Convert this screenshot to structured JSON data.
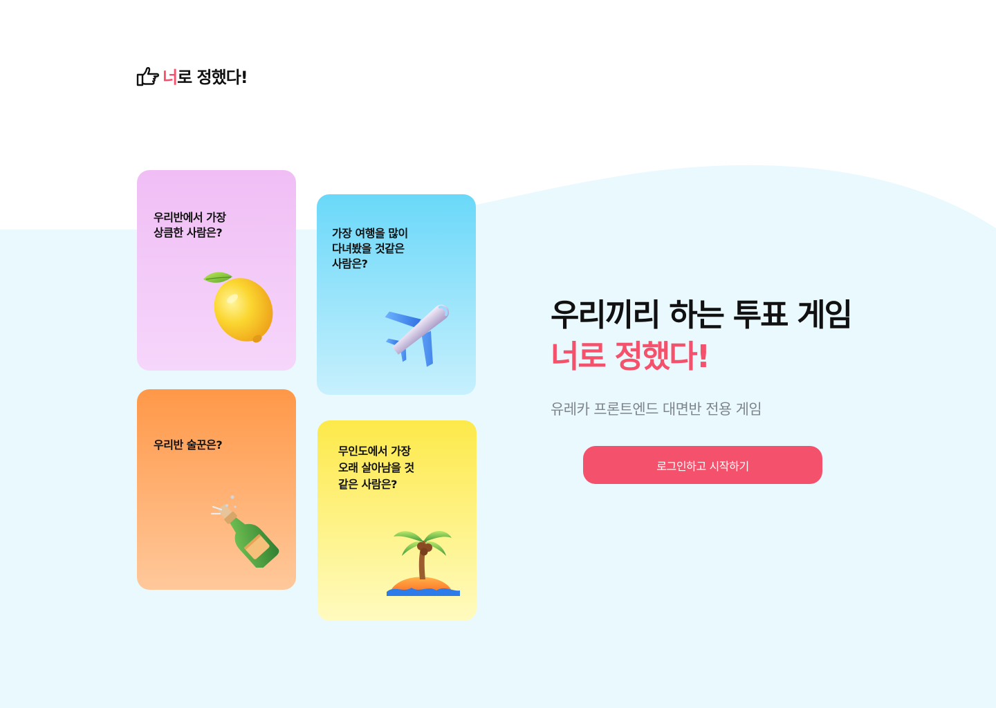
{
  "header": {
    "logo_icon": "pointing-hand-icon",
    "logo_text_accent": "너",
    "logo_text_rest": "로 정했다!"
  },
  "cards": [
    {
      "title": "우리반에서 가장\n상큼한 사람은?",
      "icon": "lemon-icon",
      "gradient": [
        "#f0bef5",
        "#f6d6fb"
      ]
    },
    {
      "title": "가장 여행을 많이\n다녀봤을 것같은\n사람은?",
      "icon": "airplane-icon",
      "gradient": [
        "#6ad8f9",
        "#c7f0fd"
      ]
    },
    {
      "title": "우리반 술꾼은?",
      "icon": "champagne-bottle-icon",
      "gradient": [
        "#ff9848",
        "#ffc89b"
      ]
    },
    {
      "title": "무인도에서 가장\n오래 살아남을 것\n같은 사람은?",
      "icon": "palm-island-icon",
      "gradient": [
        "#fde94a",
        "#fffbbf"
      ]
    }
  ],
  "hero": {
    "title_line1": "우리끼리 하는 투표 게임",
    "title_line2": "너로 정했다!",
    "subtitle": "유레카 프론트엔드 대면반 전용 게임"
  },
  "cta": {
    "label": "로그인하고 시작하기"
  },
  "colors": {
    "accent": "#f4526c",
    "background_wave": "#eaf9fd",
    "text_primary": "#111111",
    "text_secondary": "#7f858c"
  }
}
